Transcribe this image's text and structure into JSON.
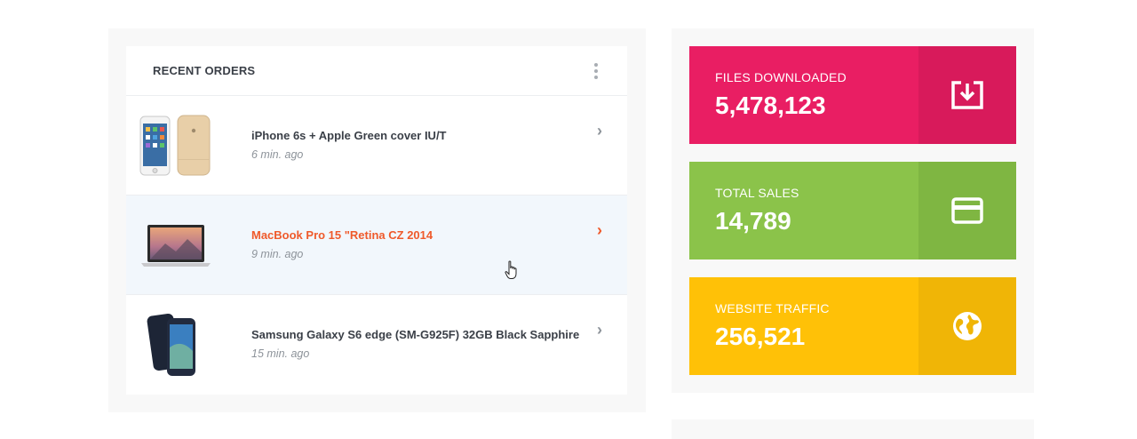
{
  "recent_orders": {
    "title": "RECENT ORDERS",
    "menu_icon": "kebab-menu-icon",
    "items": [
      {
        "name": "iPhone 6s + Apple Green cover IU/T",
        "time": "6 min. ago"
      },
      {
        "name": "MacBook Pro 15 \"Retina CZ 2014",
        "time": "9 min. ago",
        "active": true
      },
      {
        "name": "Samsung Galaxy S6 edge (SM-G925F) 32GB Black Sapphire",
        "time": "15 min. ago"
      }
    ],
    "accent": "#ef5a2b"
  },
  "stats": [
    {
      "label": "FILES DOWNLOADED",
      "value": "5,478,123",
      "icon": "download-icon",
      "color": "#e91e63"
    },
    {
      "label": "TOTAL SALES",
      "value": "14,789",
      "icon": "credit-card-icon",
      "color": "#8bc34a"
    },
    {
      "label": "WEBSITE TRAFFIC",
      "value": "256,521",
      "icon": "globe-icon",
      "color": "#ffc107"
    }
  ]
}
